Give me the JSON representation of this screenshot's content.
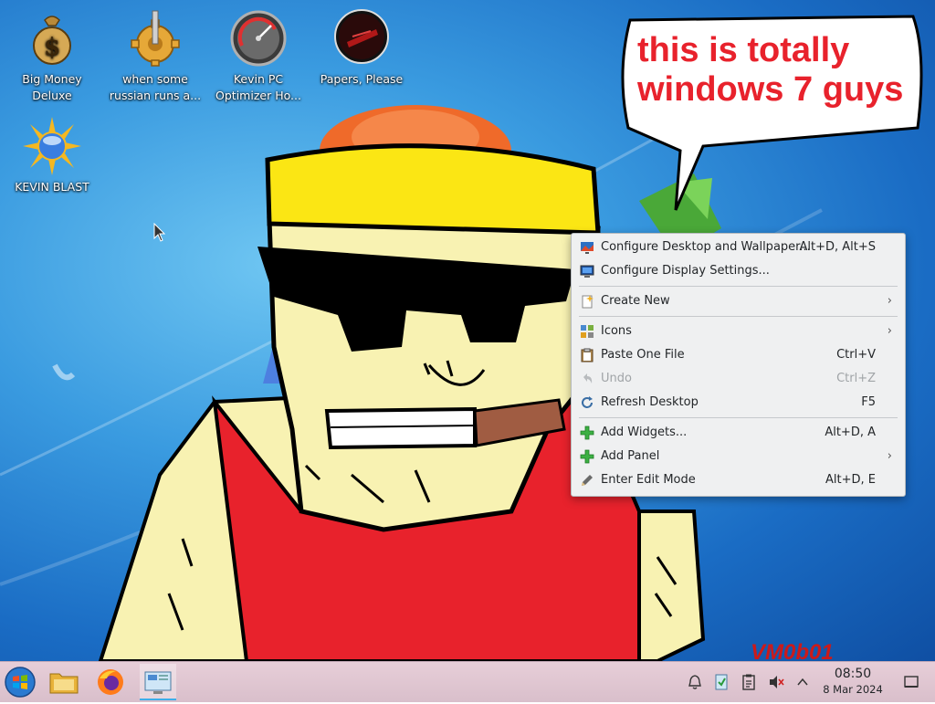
{
  "desktop": {
    "icons": [
      {
        "label1": "Big Money",
        "label2": "Deluxe"
      },
      {
        "label1": "when some",
        "label2": "russian runs a..."
      },
      {
        "label1": "Kevin PC",
        "label2": "Optimizer Ho..."
      },
      {
        "label1": "Papers, Please",
        "label2": ""
      },
      {
        "label1": "KEVIN BLAST",
        "label2": ""
      }
    ],
    "speech_bubble": {
      "line1": "this is totally",
      "line2": "windows 7 guys"
    },
    "watermark": "VM0b01",
    "icon_names": [
      "money-bag-icon",
      "gear-icon",
      "speedometer-icon",
      "papers-please-icon",
      "sun-globe-icon"
    ]
  },
  "context_menu": {
    "items": [
      {
        "label": "Configure Desktop and Wallpaper...",
        "shortcut": "Alt+D, Alt+S",
        "icon": "desktop-wallpaper-icon"
      },
      {
        "label": "Configure Display Settings...",
        "shortcut": "",
        "icon": "display-icon"
      },
      {
        "label": "Create New",
        "shortcut": "",
        "icon": "new-document-icon",
        "submenu": true
      },
      {
        "label": "Icons",
        "shortcut": "",
        "icon": "icons-grid-icon",
        "submenu": true
      },
      {
        "label": "Paste One File",
        "shortcut": "Ctrl+V",
        "icon": "paste-icon"
      },
      {
        "label": "Undo",
        "shortcut": "Ctrl+Z",
        "icon": "undo-icon",
        "disabled": true
      },
      {
        "label": "Refresh Desktop",
        "shortcut": "F5",
        "icon": "refresh-icon"
      },
      {
        "label": "Add Widgets...",
        "shortcut": "Alt+D, A",
        "icon": "plus-icon"
      },
      {
        "label": "Add Panel",
        "shortcut": "",
        "icon": "plus-icon",
        "submenu": true
      },
      {
        "label": "Enter Edit Mode",
        "shortcut": "Alt+D, E",
        "icon": "edit-icon"
      }
    ],
    "submenu_arrow": "›"
  },
  "taskbar": {
    "clock": {
      "time": "08:50",
      "date": "8 Mar 2024"
    },
    "accent": "#3daee9"
  }
}
